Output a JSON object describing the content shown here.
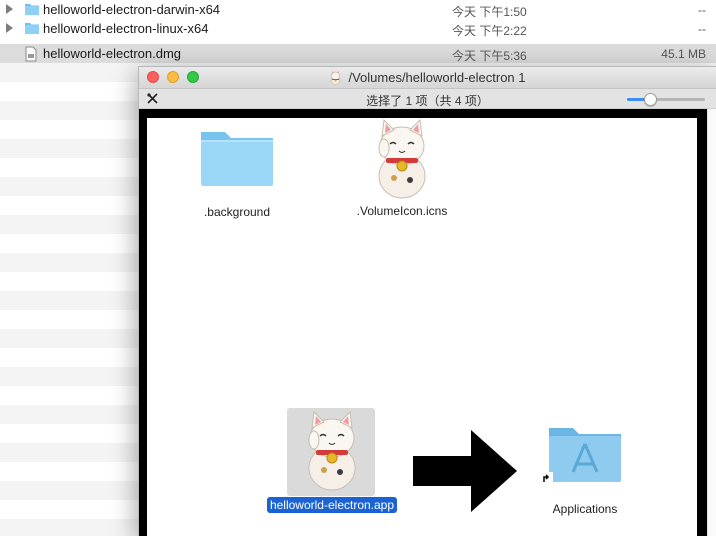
{
  "finder_list": {
    "rows": [
      {
        "name": "helloworld-electron-darwin-x64",
        "date": "今天 下午1:50",
        "size": "--",
        "kind": "folder"
      },
      {
        "name": "helloworld-electron-linux-x64",
        "date": "今天 下午2:22",
        "size": "--",
        "kind": "folder"
      },
      {
        "name": "helloworld-electron.dmg",
        "date": "今天 下午5:36",
        "size": "45.1 MB",
        "kind": "dmg"
      }
    ]
  },
  "dmg_window": {
    "title": "/Volumes/helloworld-electron 1",
    "status": "选择了 1 项（共 4 项）",
    "icon_size_slider": 0.3,
    "items": {
      "background": ".background",
      "volume_icon": ".VolumeIcon.icns",
      "app": "helloworld-electron.app",
      "applications": "Applications"
    }
  },
  "colors": {
    "selection_blue": "#1b63d3",
    "folder_blue": "#8fd0f5",
    "close": "#fc605c",
    "minimize": "#fdbc40",
    "maximize": "#34c84a"
  }
}
